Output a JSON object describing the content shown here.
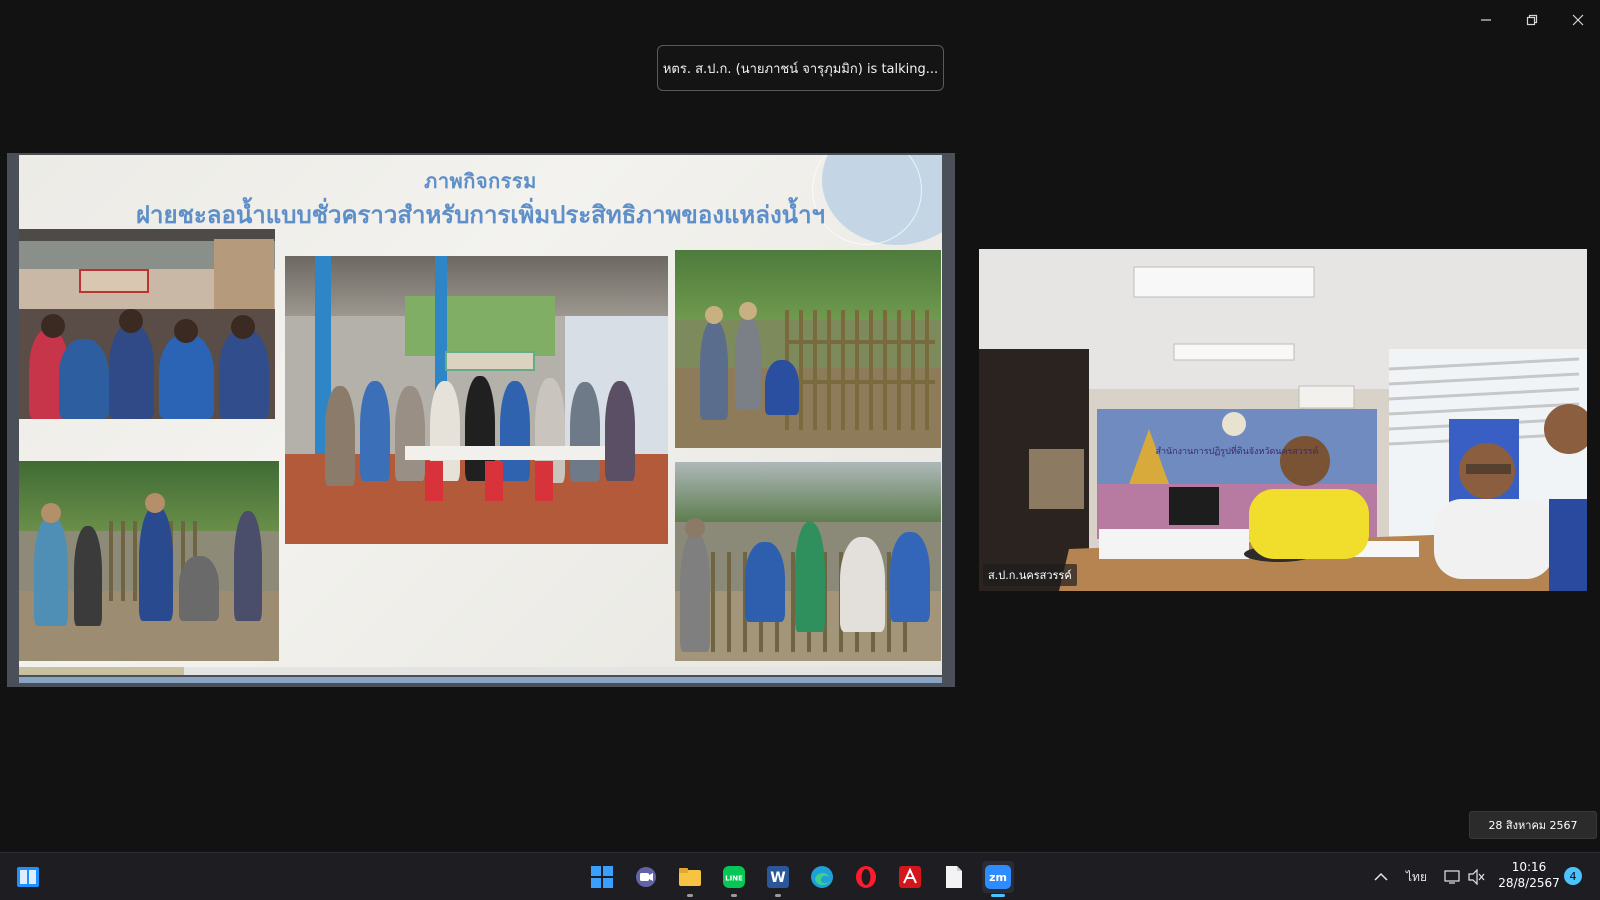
{
  "window": {
    "controls": [
      {
        "name": "minimize-icon"
      },
      {
        "name": "restore-icon"
      },
      {
        "name": "close-icon"
      }
    ]
  },
  "meeting": {
    "talking_text": "หตร. ส.ป.ก. (นายภาชน์  จารุภุมมิก) is talking..."
  },
  "slide": {
    "title": "ภาพกิจกรรม",
    "subtitle": "ฝายชะลอน้ำแบบชั่วคราวสำหรับการเพิ่มประสิทธิภาพของแหล่งน้ำฯ"
  },
  "video": {
    "participant_name": "ส.ป.ก.นครสวรรค์",
    "sign_text": "สำนักงานการปฏิรูปที่ดินจังหวัดนครสวรรค์"
  },
  "date_tooltip": "28 สิงหาคม 2567",
  "taskbar": {
    "apps": [
      {
        "name": "widgets-icon"
      },
      {
        "name": "start-icon"
      },
      {
        "name": "meet-icon"
      },
      {
        "name": "file-explorer-icon"
      },
      {
        "name": "line-icon"
      },
      {
        "name": "word-icon"
      },
      {
        "name": "edge-icon"
      },
      {
        "name": "opera-icon"
      },
      {
        "name": "acrobat-icon"
      },
      {
        "name": "notepad-icon"
      },
      {
        "name": "zoom-icon"
      }
    ],
    "tray": {
      "language": "ไทย",
      "time": "10:16",
      "date": "28/8/2567",
      "notification_count": "4"
    },
    "zoom_label": "zm",
    "line_label": "LINE",
    "word_label": "W"
  },
  "colors": {
    "accent": "#4cc2ff",
    "slide_title": "#5f8fc9",
    "background": "#121212"
  }
}
